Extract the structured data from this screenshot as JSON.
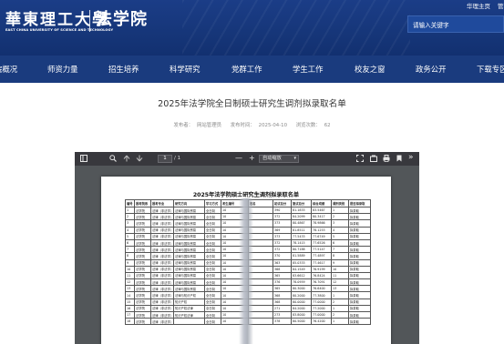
{
  "header": {
    "university_name": "華東理工大學",
    "university_en": "EAST CHINA UNIVERSITY OF SCIENCE AND TECHNOLOGY",
    "department": "法学院",
    "top_links": [
      "华理主页",
      "管理"
    ],
    "search_placeholder": "请输入关键字"
  },
  "nav": {
    "items": [
      "院概况",
      "师资力量",
      "招生培养",
      "科学研究",
      "党群工作",
      "学生工作",
      "校友之窗",
      "政务公开",
      "下载专区"
    ]
  },
  "article": {
    "title": "2025年法学院全日制硕士研究生调剂拟录取名单",
    "publisher_label": "发布者：",
    "publisher": "网站管理员",
    "date_label": "发布时间：",
    "date": "2025-04-10",
    "views_label": "浏览次数：",
    "views": "62"
  },
  "pdf_viewer": {
    "toolbar_icons": [
      "sidebar-toggle-icon",
      "search-icon",
      "previous-page-icon",
      "next-page-icon",
      "zoom-out-icon",
      "zoom-in-icon",
      "presentation-mode-icon",
      "open-file-icon",
      "print-icon",
      "bookmark-icon",
      "more-tools-icon"
    ],
    "page_number": "1",
    "page_total": "/ 1",
    "zoom_out_label": "—",
    "zoom_in_label": "+",
    "zoom_value": "自动缩放",
    "document": {
      "table_title": "2025年法学院硕士研究生调剂拟录取名单",
      "headers": [
        "编号",
        "报考院系",
        "报考专业",
        "研究方向",
        "学习方式",
        "考生编号",
        "姓名",
        "初试总分",
        "复试总分",
        "综合成绩",
        "调剂类别",
        "是否拟录取"
      ],
      "rows": [
        [
          "1",
          "法学院",
          "法律（非法学）",
          "法律与国际贸易",
          "全日制",
          "10",
          "",
          "390",
          "81.1833",
          "83.5467",
          "1",
          "拟录取"
        ],
        [
          "2",
          "法学院",
          "法律（非法学）",
          "法律与国际贸易",
          "全日制",
          "10",
          "",
          "372",
          "84.2099",
          "80.3417",
          "2",
          "拟录取"
        ],
        [
          "3",
          "法学院",
          "法律（非法学）",
          "法律与国际贸易",
          "全日制",
          "10",
          "",
          "373",
          "80.4867",
          "78.9866",
          "3",
          "拟录取"
        ],
        [
          "4",
          "法学院",
          "法律（非法学）",
          "法律与国际贸易",
          "全日制",
          "10",
          "",
          "369",
          "81.8511",
          "78.1253",
          "4",
          "拟录取"
        ],
        [
          "5",
          "法学院",
          "法律（非法学）",
          "法律与国际贸易",
          "全日制",
          "10",
          "",
          "373",
          "77.5433",
          "77.6749",
          "5",
          "拟录取"
        ],
        [
          "6",
          "法学院",
          "法律（非法学）",
          "法律与国际贸易",
          "全日制",
          "10",
          "",
          "372",
          "78.1415",
          "77.6526",
          "6",
          "拟录取"
        ],
        [
          "7",
          "法学院",
          "法律（非法学）",
          "法律与国际贸易",
          "全日制",
          "10",
          "",
          "372",
          "80.7188",
          "77.5147",
          "7",
          "拟录取"
        ],
        [
          "8",
          "法学院",
          "法律（非法学）",
          "法律与国际贸易",
          "全日制",
          "10",
          "",
          "370",
          "81.5889",
          "77.4897",
          "8",
          "拟录取"
        ],
        [
          "9",
          "法学院",
          "法律（非法学）",
          "法律与国际贸易",
          "全日制",
          "10",
          "",
          "363",
          "85.0333",
          "77.4617",
          "9",
          "拟录取"
        ],
        [
          "10",
          "法学院",
          "法律（非法学）",
          "法律与国际贸易",
          "全日制",
          "10",
          "",
          "368",
          "84.1549",
          "76.9199",
          "10",
          "拟录取"
        ],
        [
          "11",
          "法学院",
          "法律（非法学）",
          "法律与国际贸易",
          "全日制",
          "10",
          "",
          "365",
          "83.6612",
          "76.8424",
          "11",
          "拟录取"
        ],
        [
          "12",
          "法学院",
          "法律（非法学）",
          "法律与国际贸易",
          "全日制",
          "10",
          "",
          "376",
          "78.0959",
          "76.7091",
          "12",
          "拟录取"
        ],
        [
          "13",
          "法学院",
          "法律（非法学）",
          "法律与国际贸易",
          "全日制",
          "10",
          "",
          "365",
          "80.3000",
          "76.6400",
          "13",
          "拟录取"
        ],
        [
          "14",
          "法学院",
          "法律（非法学）",
          "法律与知识产权",
          "全日制",
          "10",
          "",
          "368",
          "80.2000",
          "77.3800",
          "1",
          "拟录取"
        ],
        [
          "15",
          "法学院",
          "法律（非法学）",
          "知识产权",
          "全日制",
          "10",
          "",
          "368",
          "80.0000",
          "77.0000",
          "2",
          "拟录取"
        ],
        [
          "16",
          "法学院",
          "法律（非法学）",
          "知识产权法律",
          "全日制",
          "10",
          "",
          "271",
          "84.2000",
          "77.2000",
          "1",
          "拟录取"
        ],
        [
          "17",
          "法学院",
          "法律（非法学）",
          "知识产权法律",
          "全日制",
          "10",
          "",
          "273",
          "83.8000",
          "77.0000",
          "2",
          "拟录取"
        ],
        [
          "18",
          "法学院",
          "法律（非法学）",
          "",
          "全日制",
          "10",
          "",
          "378",
          "80.5000",
          "76.4200",
          "1",
          "拟录取"
        ]
      ]
    }
  },
  "colors": {
    "header_bg": "#173a80",
    "nav_bg": "#1a3b7e",
    "viewer_bg": "#525659",
    "viewer_toolbar_bg": "#38383d"
  }
}
